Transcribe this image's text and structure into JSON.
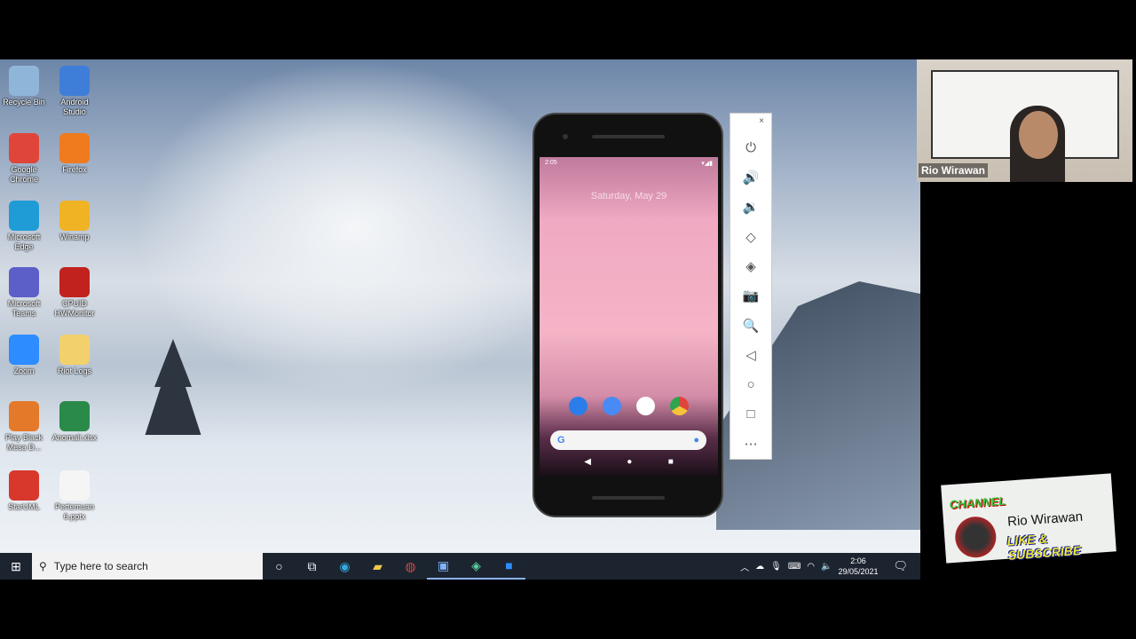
{
  "desktop": {
    "icons": [
      {
        "label": "Recycle Bin",
        "color": "#8fb6d8"
      },
      {
        "label": "Android Studio",
        "color": "#3f7ed8"
      },
      {
        "label": "Google Chrome",
        "color": "#e0453a"
      },
      {
        "label": "Firefox",
        "color": "#f07a1e"
      },
      {
        "label": "Microsoft Edge",
        "color": "#1f9bd6"
      },
      {
        "label": "Winamp",
        "color": "#f0b323"
      },
      {
        "label": "Microsoft Teams",
        "color": "#5b5fc7"
      },
      {
        "label": "CPUID HWMonitor",
        "color": "#c2221d"
      },
      {
        "label": "Zoom",
        "color": "#2d8cff"
      },
      {
        "label": "Riot Logs",
        "color": "#f2d06b"
      },
      {
        "label": "Play Black Mesa D...",
        "color": "#e5792a"
      },
      {
        "label": "Anomali.xlsx",
        "color": "#2a8a4a"
      },
      {
        "label": "StarUML",
        "color": "#d8372c"
      },
      {
        "label": "Pertemuan 6.pptx",
        "color": "#f5f5f5"
      }
    ]
  },
  "taskbar": {
    "search_placeholder": "Type here to search",
    "time": "2:06",
    "date": "29/05/2021"
  },
  "phone": {
    "status_time": "2:05",
    "date": "Saturday, May 29",
    "search_logo": "G"
  },
  "emulator_toolbar": {
    "close": "×",
    "buttons": [
      "power",
      "volume-up",
      "volume-down",
      "rotate-left",
      "rotate-right",
      "screenshot",
      "zoom",
      "back",
      "home",
      "overview",
      "more"
    ]
  },
  "webcam": {
    "name": "Rio Wirawan"
  },
  "channel_card": {
    "tag": "CHANNEL",
    "name": "Rio Wirawan",
    "cta": "LIKE & SUBSCRIBE"
  }
}
